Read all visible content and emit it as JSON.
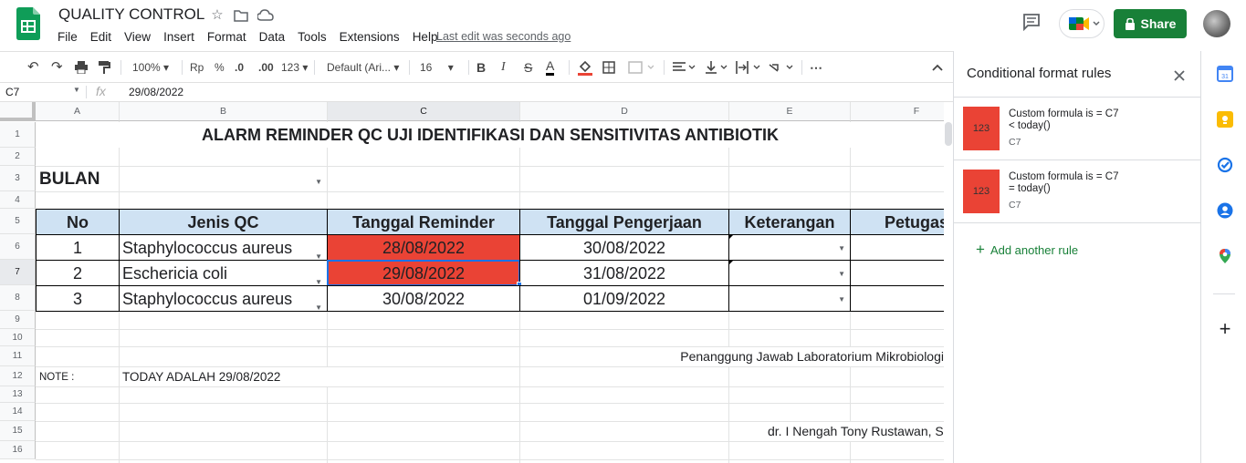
{
  "app": {
    "title": "QUALITY CONTROL",
    "menu": [
      "File",
      "Edit",
      "View",
      "Insert",
      "Format",
      "Data",
      "Tools",
      "Extensions",
      "Help"
    ],
    "last_edit": "Last edit was seconds ago",
    "share_label": "Share"
  },
  "toolbar": {
    "zoom": "100%",
    "currency": "Rp",
    "percent": "%",
    "dec_less": ".0",
    "dec_more": ".00",
    "more_formats": "123",
    "font": "Default (Ari...",
    "font_size": "16"
  },
  "formula_bar": {
    "cell_ref": "C7",
    "fx": "fx",
    "value": "29/08/2022"
  },
  "sheet": {
    "columns": [
      "A",
      "B",
      "C",
      "D",
      "E",
      "F"
    ],
    "rows": [
      "1",
      "2",
      "3",
      "4",
      "5",
      "6",
      "7",
      "8",
      "9",
      "10",
      "11",
      "12",
      "13",
      "14",
      "15",
      "16"
    ],
    "title": "ALARM REMINDER QC UJI IDENTIFIKASI DAN SENSITIVITAS ANTIBIOTIK",
    "bulan_label": "BULAN",
    "headers": [
      "No",
      "Jenis QC",
      "Tanggal Reminder",
      "Tanggal Pengerjaan",
      "Keterangan",
      "Petugas"
    ],
    "data_rows": [
      {
        "no": "1",
        "jenis": "Staphylococcus aureus",
        "reminder": "28/08/2022",
        "pengerjaan": "30/08/2022"
      },
      {
        "no": "2",
        "jenis": "Eschericia coli",
        "reminder": "29/08/2022",
        "pengerjaan": "31/08/2022"
      },
      {
        "no": "3",
        "jenis": "Staphylococcus aureus",
        "reminder": "30/08/2022",
        "pengerjaan": "01/09/2022"
      }
    ],
    "penanggung": "Penanggung Jawab Laboratorium Mikrobiologi",
    "note_label": "NOTE :",
    "note_text": "TODAY ADALAH 29/08/2022",
    "signer": "dr. I Nengah Tony Rustawan, S"
  },
  "panel": {
    "title": "Conditional format rules",
    "rules": [
      {
        "swatch": "123",
        "text": "Custom formula is = C7\n< today()",
        "range": "C7"
      },
      {
        "swatch": "123",
        "text": "Custom formula is = C7\n= today()",
        "range": "C7"
      }
    ],
    "add_rule": "Add another rule"
  },
  "colors": {
    "accent": "#188038",
    "highlight": "#ea4335",
    "header_fill": "#cfe2f3"
  }
}
